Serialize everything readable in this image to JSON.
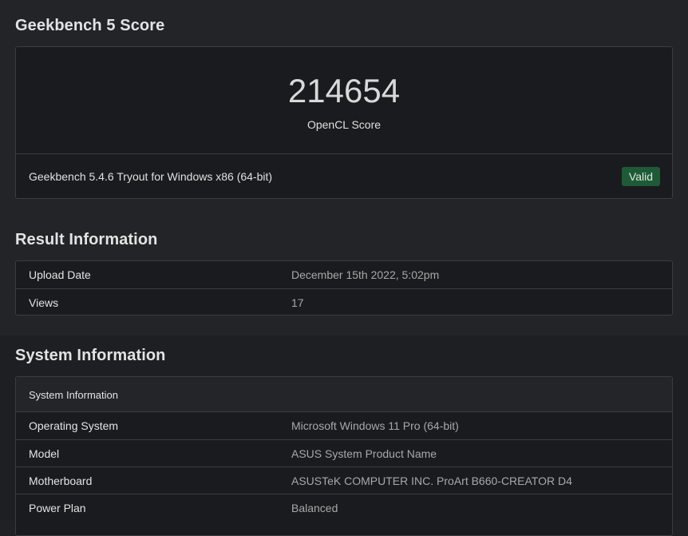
{
  "score_section": {
    "heading": "Geekbench 5 Score",
    "score": "214654",
    "score_label": "OpenCL Score",
    "version": "Geekbench 5.4.6 Tryout for Windows x86 (64-bit)",
    "badge": "Valid"
  },
  "result_information": {
    "heading": "Result Information",
    "rows": [
      {
        "key": "Upload Date",
        "value": "December 15th 2022, 5:02pm"
      },
      {
        "key": "Views",
        "value": "17"
      }
    ]
  },
  "system_information": {
    "heading": "System Information",
    "panel_title": "System Information",
    "rows": [
      {
        "key": "Operating System",
        "value": "Microsoft Windows 11 Pro (64-bit)"
      },
      {
        "key": "Model",
        "value": "ASUS System Product Name"
      },
      {
        "key": "Motherboard",
        "value": "ASUSTeK COMPUTER INC. ProArt B660-CREATOR D4"
      },
      {
        "key": "Power Plan",
        "value": "Balanced"
      }
    ]
  },
  "colors": {
    "valid_badge_bg": "#1f5a37",
    "panel_border": "#3a3d42"
  }
}
